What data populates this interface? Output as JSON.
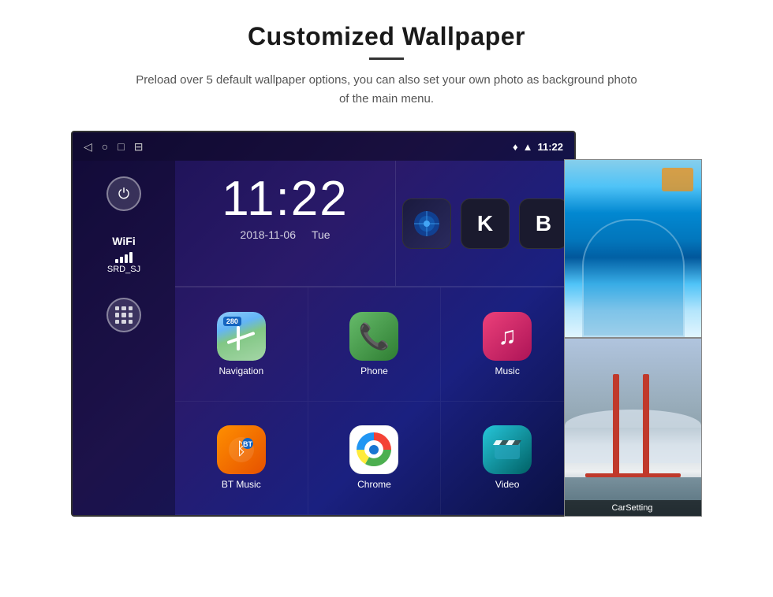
{
  "header": {
    "title": "Customized Wallpaper",
    "description": "Preload over 5 default wallpaper options, you can also set your own photo as background photo of the main menu."
  },
  "device": {
    "status_bar": {
      "time": "11:22",
      "nav_icons": [
        "◁",
        "○",
        "□",
        "⊟"
      ]
    },
    "clock": {
      "time": "11:22",
      "date": "2018-11-06",
      "day": "Tue"
    },
    "wifi": {
      "label": "WiFi",
      "network": "SRD_SJ"
    },
    "apps": [
      {
        "label": "Navigation",
        "icon": "navigation"
      },
      {
        "label": "Phone",
        "icon": "phone"
      },
      {
        "label": "Music",
        "icon": "music"
      },
      {
        "label": "BT Music",
        "icon": "btmusic"
      },
      {
        "label": "Chrome",
        "icon": "chrome"
      },
      {
        "label": "Video",
        "icon": "video"
      }
    ],
    "wallpapers": [
      "ice_cave",
      "golden_gate"
    ],
    "carsetting_label": "CarSetting"
  }
}
